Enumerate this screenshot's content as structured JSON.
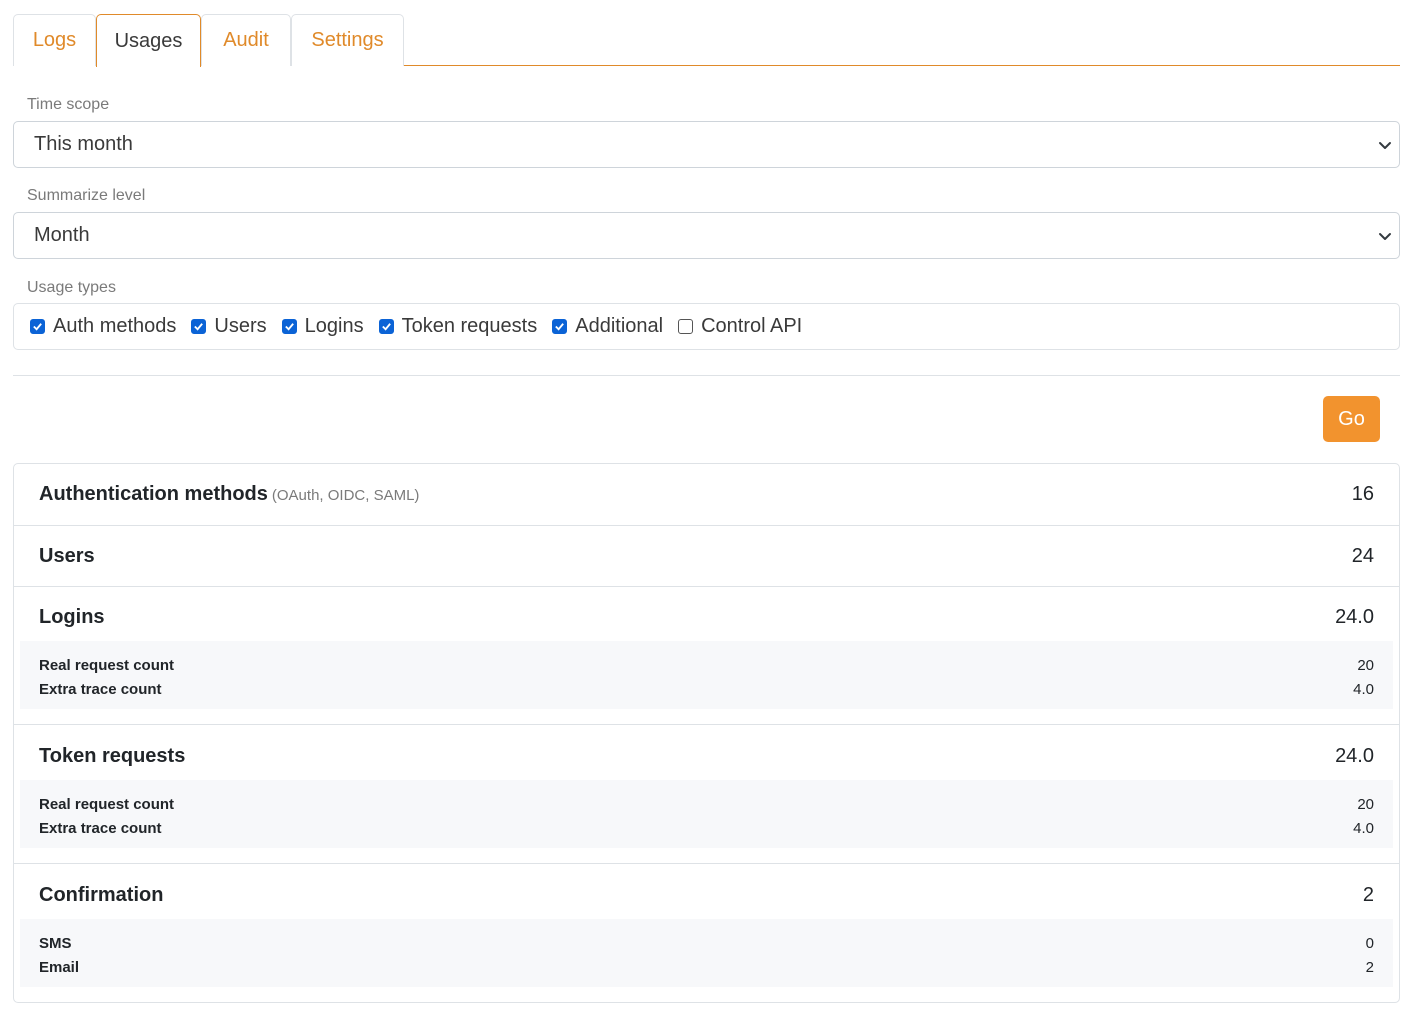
{
  "tabs": [
    {
      "label": "Logs",
      "active": false
    },
    {
      "label": "Usages",
      "active": true
    },
    {
      "label": "Audit",
      "active": false
    },
    {
      "label": "Settings",
      "active": false
    }
  ],
  "colors": {
    "accent": "#e08a2a",
    "go_button": "#f2932e",
    "checkbox_on": "#0b63d6"
  },
  "time_scope": {
    "label": "Time scope",
    "value": "This month"
  },
  "summarize_level": {
    "label": "Summarize level",
    "value": "Month"
  },
  "usage_types": {
    "label": "Usage types",
    "items": [
      {
        "label": "Auth methods",
        "checked": true
      },
      {
        "label": "Users",
        "checked": true
      },
      {
        "label": "Logins",
        "checked": true
      },
      {
        "label": "Token requests",
        "checked": true
      },
      {
        "label": "Additional",
        "checked": true
      },
      {
        "label": "Control API",
        "checked": false
      }
    ]
  },
  "go_label": "Go",
  "results": {
    "auth_methods": {
      "title": "Authentication methods",
      "subtitle": "(OAuth, OIDC, SAML)",
      "value": "16"
    },
    "users": {
      "title": "Users",
      "value": "24"
    },
    "logins": {
      "title": "Logins",
      "value": "24.0",
      "details": [
        {
          "label": "Real request count",
          "value": "20"
        },
        {
          "label": "Extra trace count",
          "value": "4.0"
        }
      ]
    },
    "token_requests": {
      "title": "Token requests",
      "value": "24.0",
      "details": [
        {
          "label": "Real request count",
          "value": "20"
        },
        {
          "label": "Extra trace count",
          "value": "4.0"
        }
      ]
    },
    "confirmation": {
      "title": "Confirmation",
      "value": "2",
      "details": [
        {
          "label": "SMS",
          "value": "0"
        },
        {
          "label": "Email",
          "value": "2"
        }
      ]
    }
  }
}
